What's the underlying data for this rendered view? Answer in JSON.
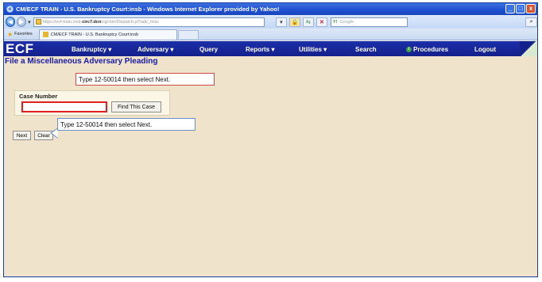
{
  "window": {
    "title": "CM/ECF TRAIN - U.S. Bankruptcy Court:insb - Windows Internet Explorer provided by Yahoo!",
    "minimize": "_",
    "maximize": "□",
    "close": "x"
  },
  "addressbar": {
    "url_prefix": "https://ecf-train.insb.",
    "url_domain": "circ7.dcn",
    "url_rest": "/cgi-bin/Dispatch.pl?adv_misc",
    "search_placeholder": "Google",
    "search_engine_glyph": "Y!"
  },
  "favorites": {
    "label": "Favorites"
  },
  "tab": {
    "title": "CM/ECF TRAIN - U.S. Bankruptcy Court:insb"
  },
  "ecf_menu": {
    "logo": "ECF",
    "items": [
      {
        "label": "Bankruptcy",
        "has_dropdown": true
      },
      {
        "label": "Adversary",
        "has_dropdown": true
      },
      {
        "label": "Query",
        "has_dropdown": false
      },
      {
        "label": "Reports",
        "has_dropdown": true
      },
      {
        "label": "Utilities",
        "has_dropdown": true
      },
      {
        "label": "Search",
        "has_dropdown": false
      },
      {
        "label": "Procedures",
        "has_dropdown": false
      },
      {
        "label": "Logout",
        "has_dropdown": false
      }
    ],
    "bankruptcy_label": "Bankruptcy ▾",
    "adversary_label": "Adversary ▾",
    "query_label": "Query",
    "reports_label": "Reports ▾",
    "utilities_label": "Utilities ▾",
    "search_label": "Search",
    "procedures_label": "Procedures",
    "logout_label": "Logout"
  },
  "page": {
    "title": "File a Miscellaneous Adversary Pleading",
    "case_number_label": "Case Number",
    "case_number_value": "",
    "find_button": "Find This Case",
    "next_button": "Next",
    "clear_button": "Clear"
  },
  "callouts": {
    "top": "Type 12-50014 then select Next.",
    "bottom": "Type 12-50014 then select Next."
  },
  "colors": {
    "menubar": "#14208c",
    "content_bg": "#efe3cb",
    "title_text": "#1a1aa8",
    "highlight_border": "#e02020"
  }
}
